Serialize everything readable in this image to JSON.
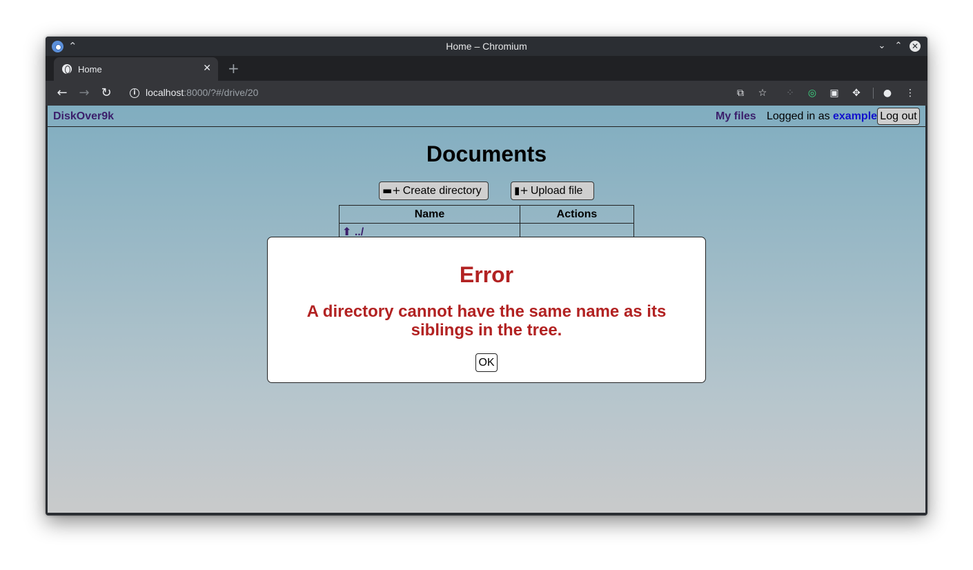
{
  "browser": {
    "window_title": "Home – Chromium",
    "tab_title": "Home",
    "url_host": "localhost",
    "url_rest": ":8000/?#/drive/20"
  },
  "app": {
    "brand": "DiskOver9k",
    "nav_myfiles": "My files",
    "logged_in_prefix": "Logged in as",
    "username": "example",
    "logout_label": "Log out"
  },
  "page": {
    "title": "Documents",
    "create_dir_label": "Create directory",
    "upload_label": "Upload file",
    "table": {
      "headers": [
        "Name",
        "Actions"
      ],
      "rows": [
        {
          "name": "../"
        }
      ]
    }
  },
  "dialog": {
    "title": "Error",
    "message": "A directory cannot have the same name as its siblings in the tree.",
    "ok_label": "OK"
  },
  "colors": {
    "error_text": "#b22222",
    "brand_link": "#3b1f6b",
    "username_link": "#1212cc"
  }
}
